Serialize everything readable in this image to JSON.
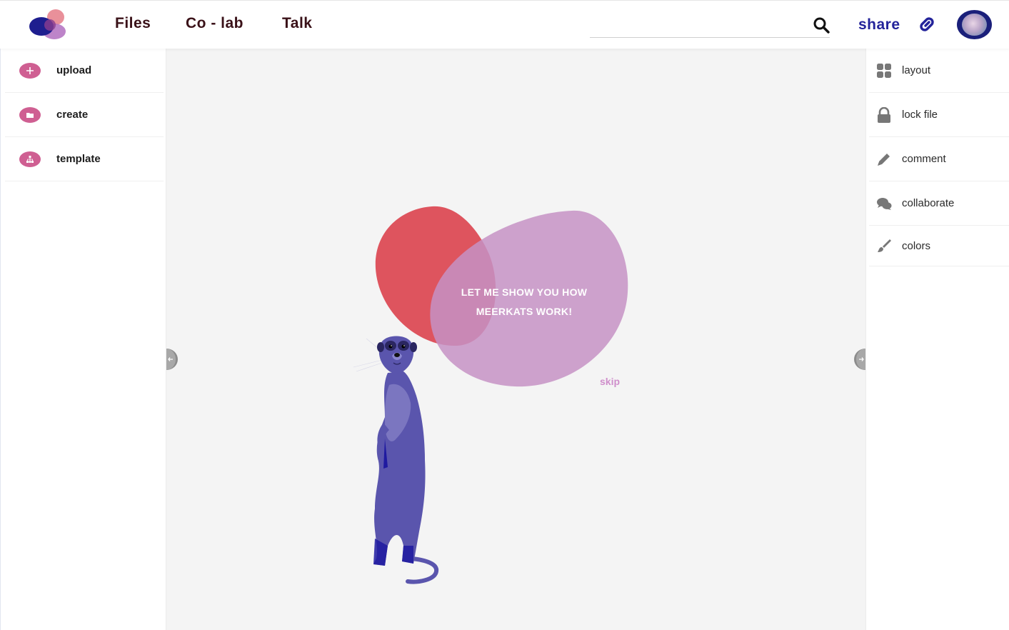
{
  "header": {
    "nav": [
      {
        "label": "Files"
      },
      {
        "label": "Co - lab"
      },
      {
        "label": "Talk"
      }
    ],
    "search": {
      "value": "",
      "placeholder": ""
    },
    "share_label": "share"
  },
  "left_sidebar": {
    "items": [
      {
        "label": "upload",
        "icon": "plus-icon"
      },
      {
        "label": "create",
        "icon": "folder-icon"
      },
      {
        "label": "template",
        "icon": "template-icon"
      }
    ]
  },
  "right_sidebar": {
    "items": [
      {
        "label": "layout",
        "icon": "grid-icon"
      },
      {
        "label": "lock file",
        "icon": "lock-icon"
      },
      {
        "label": "comment",
        "icon": "pencil-icon"
      },
      {
        "label": "collaborate",
        "icon": "chat-icon"
      },
      {
        "label": "colors",
        "icon": "brush-icon"
      }
    ]
  },
  "onboarding": {
    "bubble_line1": "LET ME SHOW YOU HOW",
    "bubble_line2": "MEERKATS WORK!",
    "skip_label": "skip"
  },
  "colors": {
    "brand_navy": "#23239a",
    "nav_text": "#3a1118",
    "accent_pink": "#cf5f92",
    "bubble_red": "#dc4b55",
    "bubble_purple": "#c79ac6",
    "meerkat": "#5a55ad",
    "canvas_bg": "#f4f4f4"
  }
}
